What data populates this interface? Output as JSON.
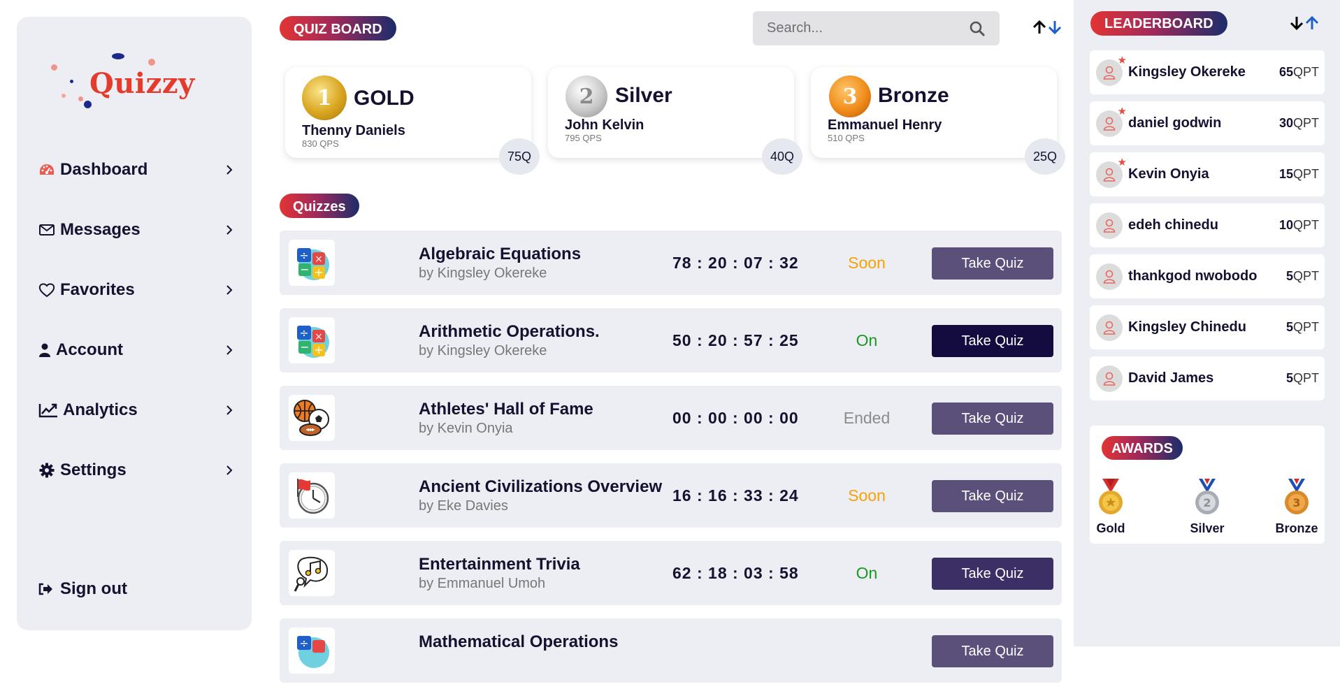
{
  "app": {
    "name": "Quizzy"
  },
  "sidebar": {
    "items": [
      {
        "label": "Dashboard",
        "icon": "dashboard-icon"
      },
      {
        "label": "Messages",
        "icon": "envelope-icon"
      },
      {
        "label": "Favorites",
        "icon": "heart-icon"
      },
      {
        "label": "Account",
        "icon": "user-icon"
      },
      {
        "label": "Analytics",
        "icon": "chart-line-icon"
      },
      {
        "label": "Settings",
        "icon": "gear-icon"
      }
    ],
    "signout": "Sign out"
  },
  "header": {
    "quiz_board_label": "QUIZ BOARD",
    "search_placeholder": "Search..."
  },
  "podium": [
    {
      "medal_number": "1",
      "title": "GOLD",
      "name": "Thenny Daniels",
      "points": "830 QPS",
      "count": "75Q"
    },
    {
      "medal_number": "2",
      "title": "Silver",
      "name": "John Kelvin",
      "points": "795 QPS",
      "count": "40Q"
    },
    {
      "medal_number": "3",
      "title": "Bronze",
      "name": "Emmanuel Henry",
      "points": "510 QPS",
      "count": "25Q"
    }
  ],
  "quizzes_label": "Quizzes",
  "quizzes": [
    {
      "title": "Algebraic Equations",
      "author": "by Kingsley Okereke",
      "timer": "78 : 20 : 07 : 32",
      "status": "Soon",
      "button": "Take Quiz",
      "icon": "math-icon"
    },
    {
      "title": "Arithmetic Operations.",
      "author": "by Kingsley Okereke",
      "timer": "50 : 20 : 57 : 25",
      "status": "On",
      "button": "Take Quiz",
      "icon": "math-icon"
    },
    {
      "title": "Athletes' Hall of Fame",
      "author": "by Kevin Onyia",
      "timer": "00 : 00 : 00 : 00",
      "status": "Ended",
      "button": "Take Quiz",
      "icon": "sports-icon"
    },
    {
      "title": "Ancient Civilizations Overview",
      "author": "by Eke Davies",
      "timer": "16 : 16 : 33 : 24",
      "status": "Soon",
      "button": "Take Quiz",
      "icon": "history-icon"
    },
    {
      "title": "Entertainment Trivia",
      "author": "by Emmanuel Umoh",
      "timer": "62 : 18 : 03 : 58",
      "status": "On",
      "button": "Take Quiz",
      "icon": "music-icon"
    },
    {
      "title": "Mathematical Operations",
      "author": "",
      "timer": "",
      "status": "",
      "button": "Take Quiz",
      "icon": "math-icon"
    }
  ],
  "leaderboard": {
    "label": "LEADERBOARD",
    "entries": [
      {
        "name": "Kingsley Okereke",
        "score": "65",
        "unit": "QPT",
        "starred": true
      },
      {
        "name": "daniel godwin",
        "score": "30",
        "unit": "QPT",
        "starred": true
      },
      {
        "name": "Kevin Onyia",
        "score": "15",
        "unit": "QPT",
        "starred": true
      },
      {
        "name": "edeh chinedu",
        "score": "10",
        "unit": "QPT",
        "starred": false
      },
      {
        "name": "thankgod nwobodo",
        "score": "5",
        "unit": "QPT",
        "starred": false
      },
      {
        "name": "Kingsley Chinedu",
        "score": "5",
        "unit": "QPT",
        "starred": false
      },
      {
        "name": "David James",
        "score": "5",
        "unit": "QPT",
        "starred": false
      }
    ]
  },
  "awards": {
    "label": "AWARDS",
    "items": [
      {
        "label": "Gold"
      },
      {
        "label": "Silver"
      },
      {
        "label": "Bronze"
      }
    ]
  },
  "colors": {
    "accent_red": "#e23434",
    "accent_navy": "#1b2c6b",
    "button_dark": "#140c3f",
    "button_muted": "#5a507a",
    "button_mid": "#3c2f66",
    "status_soon": "#f4a20a",
    "status_on": "#169b1e",
    "status_ended": "#8c8c8c"
  }
}
